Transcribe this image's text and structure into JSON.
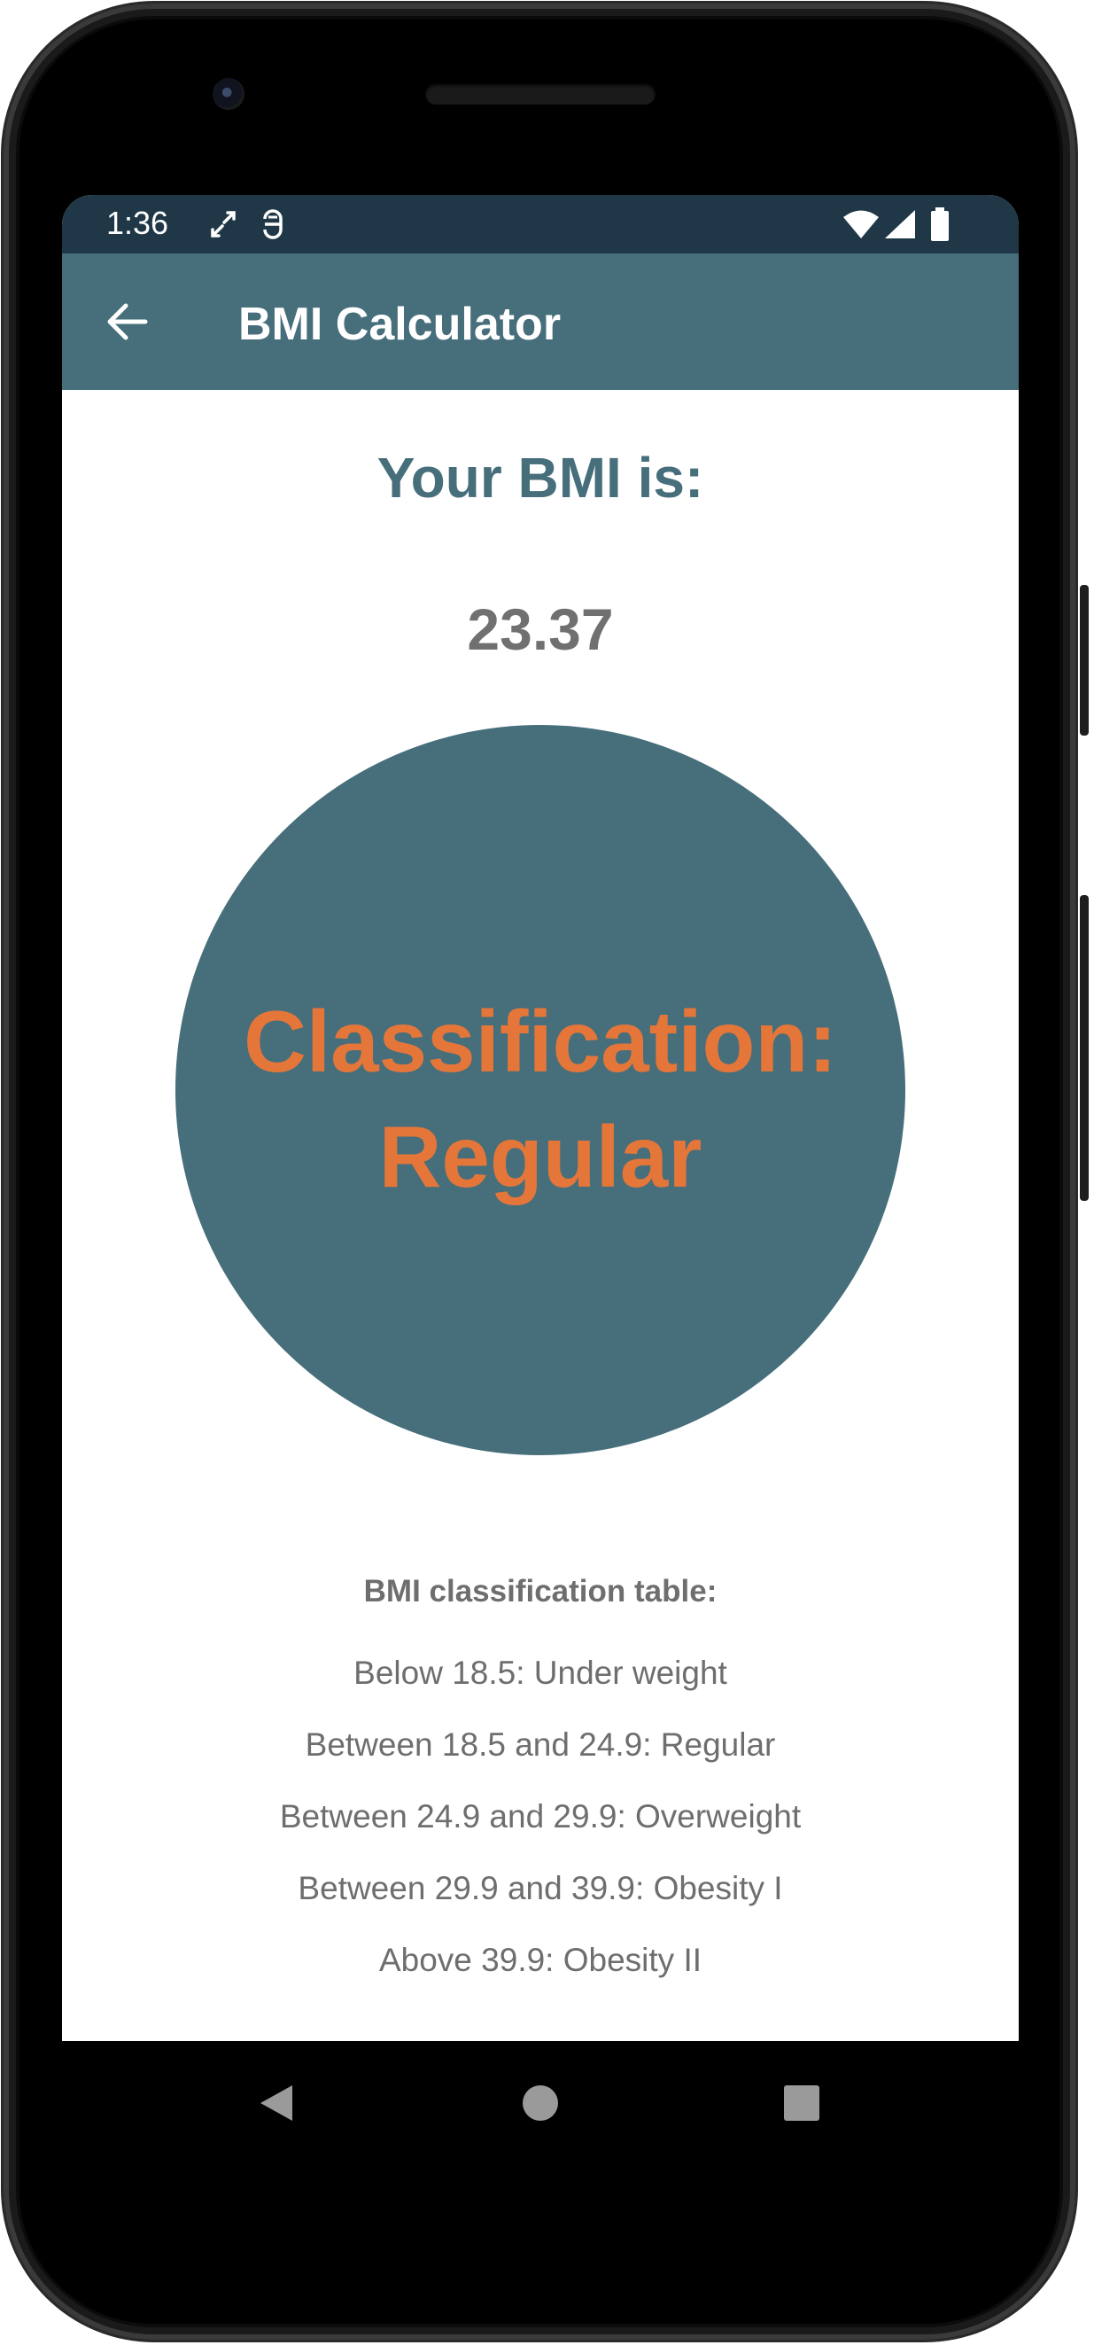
{
  "status_bar": {
    "time": "1:36",
    "icons": [
      "screen-rotate-icon",
      "vpn-key-icon",
      "wifi-icon",
      "cellular-signal-icon",
      "battery-icon"
    ]
  },
  "app_bar": {
    "title": "BMI Calculator",
    "back_icon": "arrow-back-icon"
  },
  "result": {
    "heading": "Your BMI is:",
    "value": "23.37",
    "classification_line1": "Classification:",
    "classification_line2": "Regular"
  },
  "classification_table": {
    "title": "BMI classification table:",
    "rows": [
      "Below 18.5: Under weight",
      "Between 18.5 and 24.9: Regular",
      "Between 24.9 and 29.9: Overweight",
      "Between 29.9 and 39.9: Obesity I",
      "Above 39.9: Obesity II"
    ]
  },
  "nav_bar": {
    "icons": [
      "nav-back-icon",
      "nav-home-icon",
      "nav-recents-icon"
    ]
  },
  "colors": {
    "primary": "#466e7b",
    "primary_dark": "#1f3746",
    "accent": "#e4763a",
    "text_gray": "#707070",
    "background": "#ffffff"
  }
}
